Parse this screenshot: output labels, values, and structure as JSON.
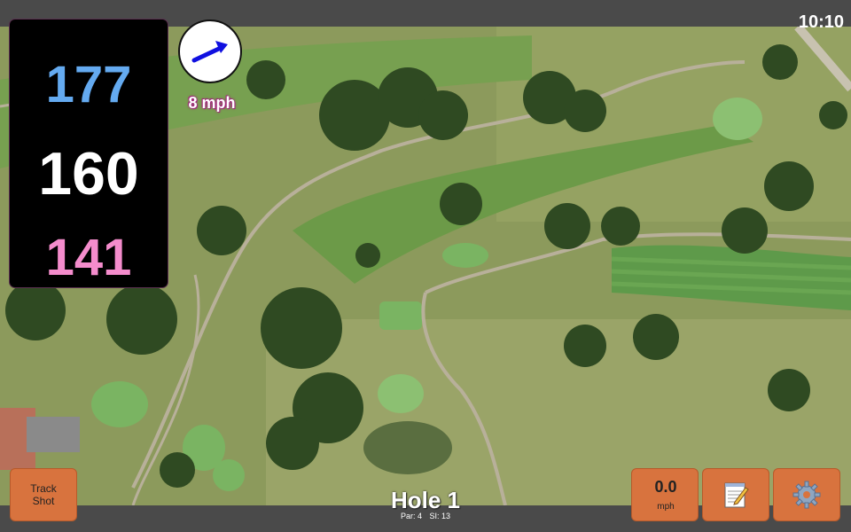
{
  "clock": "10:10",
  "distances": {
    "back": "177",
    "middle": "160",
    "front": "141"
  },
  "wind": {
    "speed_label": "8 mph",
    "direction_icon": "arrow-right-icon"
  },
  "track_shot": {
    "line1": "Track",
    "line2": "Shot"
  },
  "speed_button": {
    "value": "0.0",
    "unit": "mph"
  },
  "notes_button": {
    "icon": "notepad-icon"
  },
  "settings_button": {
    "icon": "gear-icon"
  },
  "hole": {
    "title": "Hole 1",
    "par": "Par: 4",
    "si": "SI: 13"
  },
  "colors": {
    "back_distance": "#64aaf0",
    "middle_distance": "#ffffff",
    "front_distance": "#f48ccc",
    "button": "#d8733e",
    "wind_arrow": "#1010e0"
  }
}
